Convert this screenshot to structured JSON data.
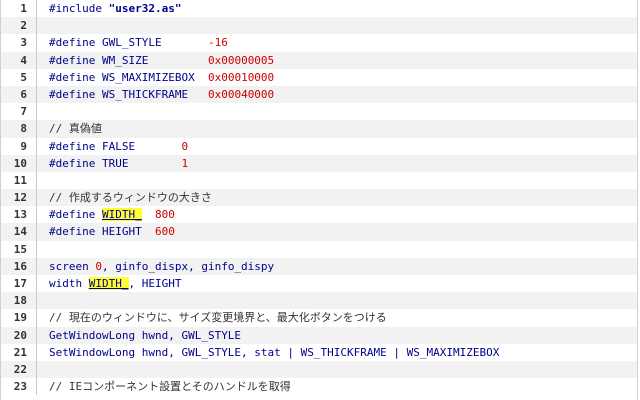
{
  "lines": [
    {
      "no": "1",
      "tokens": [
        {
          "t": "#include ",
          "c": "kw"
        },
        {
          "t": "\"user32.as\"",
          "c": "str"
        }
      ]
    },
    {
      "no": "2",
      "tokens": []
    },
    {
      "no": "3",
      "tokens": [
        {
          "t": "#define GWL_STYLE       ",
          "c": "kw"
        },
        {
          "t": "-16",
          "c": "num"
        }
      ]
    },
    {
      "no": "4",
      "tokens": [
        {
          "t": "#define WM_SIZE         ",
          "c": "kw"
        },
        {
          "t": "0x00000005",
          "c": "num"
        }
      ]
    },
    {
      "no": "5",
      "tokens": [
        {
          "t": "#define WS_MAXIMIZEBOX  ",
          "c": "kw"
        },
        {
          "t": "0x00010000",
          "c": "num"
        }
      ]
    },
    {
      "no": "6",
      "tokens": [
        {
          "t": "#define WS_THICKFRAME   ",
          "c": "kw"
        },
        {
          "t": "0x00040000",
          "c": "num"
        }
      ]
    },
    {
      "no": "7",
      "tokens": []
    },
    {
      "no": "8",
      "tokens": [
        {
          "t": "// 真偽値",
          "c": "cm"
        }
      ]
    },
    {
      "no": "9",
      "tokens": [
        {
          "t": "#define FALSE       ",
          "c": "kw"
        },
        {
          "t": "0",
          "c": "num"
        }
      ]
    },
    {
      "no": "10",
      "tokens": [
        {
          "t": "#define TRUE        ",
          "c": "kw"
        },
        {
          "t": "1",
          "c": "num"
        }
      ]
    },
    {
      "no": "11",
      "tokens": []
    },
    {
      "no": "12",
      "tokens": [
        {
          "t": "// 作成するウィンドウの大きさ",
          "c": "cm"
        }
      ]
    },
    {
      "no": "13",
      "tokens": [
        {
          "t": "#define ",
          "c": "kw"
        },
        {
          "t": "WIDTH_",
          "c": "hl"
        },
        {
          "t": "  ",
          "c": "kw"
        },
        {
          "t": "800",
          "c": "num"
        }
      ]
    },
    {
      "no": "14",
      "tokens": [
        {
          "t": "#define HEIGHT  ",
          "c": "kw"
        },
        {
          "t": "600",
          "c": "num"
        }
      ]
    },
    {
      "no": "15",
      "tokens": []
    },
    {
      "no": "16",
      "tokens": [
        {
          "t": "screen ",
          "c": "fn"
        },
        {
          "t": "0",
          "c": "num"
        },
        {
          "t": ", ginfo_dispx, ginfo_dispy",
          "c": "var"
        }
      ]
    },
    {
      "no": "17",
      "tokens": [
        {
          "t": "width ",
          "c": "fn"
        },
        {
          "t": "WIDTH_",
          "c": "hl"
        },
        {
          "t": ", HEIGHT",
          "c": "id"
        }
      ]
    },
    {
      "no": "18",
      "tokens": []
    },
    {
      "no": "19",
      "tokens": [
        {
          "t": "// 現在のウィンドウに、サイズ変更境界と、最大化ボタンをつける",
          "c": "cm"
        }
      ]
    },
    {
      "no": "20",
      "tokens": [
        {
          "t": "GetWindowLong ",
          "c": "fn"
        },
        {
          "t": "hwnd, GWL_STYLE",
          "c": "var"
        }
      ]
    },
    {
      "no": "21",
      "tokens": [
        {
          "t": "SetWindowLong ",
          "c": "fn"
        },
        {
          "t": "hwnd, GWL_STYLE, stat | WS_THICKFRAME | WS_MAXIMIZEBOX",
          "c": "var"
        }
      ]
    },
    {
      "no": "22",
      "tokens": []
    },
    {
      "no": "23",
      "tokens": [
        {
          "t": "// IEコンポーネント設置とそのハンドルを取得",
          "c": "cm"
        }
      ]
    }
  ]
}
